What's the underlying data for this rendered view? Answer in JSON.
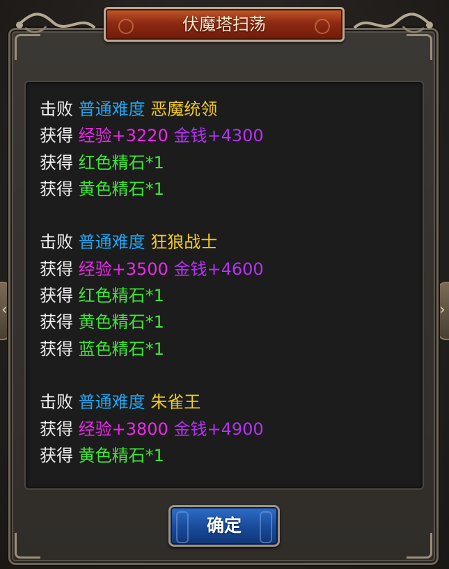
{
  "dialog": {
    "title": "伏魔塔扫荡"
  },
  "colors": {
    "label": "#f2f2f2",
    "difficulty": "#1ea6f0",
    "boss": "#f2cc1e",
    "exp": "#ea28ea",
    "money": "#b432f2",
    "item": "#3de636"
  },
  "results": [
    {
      "defeat_label": "击败",
      "difficulty": "普通难度",
      "boss": "恶魔统领",
      "gain_label": "获得",
      "exp": "经验+3220",
      "money": "金钱+4300",
      "items": [
        {
          "label": "获得",
          "name": "红色精石*1"
        },
        {
          "label": "获得",
          "name": "黄色精石*1"
        }
      ]
    },
    {
      "defeat_label": "击败",
      "difficulty": "普通难度",
      "boss": "狂狼战士",
      "gain_label": "获得",
      "exp": "经验+3500",
      "money": "金钱+4600",
      "items": [
        {
          "label": "获得",
          "name": "红色精石*1"
        },
        {
          "label": "获得",
          "name": "黄色精石*1"
        },
        {
          "label": "获得",
          "name": "蓝色精石*1"
        }
      ]
    },
    {
      "defeat_label": "击败",
      "difficulty": "普通难度",
      "boss": "朱雀王",
      "gain_label": "获得",
      "exp": "经验+3800",
      "money": "金钱+4900",
      "items": [
        {
          "label": "获得",
          "name": "黄色精石*1"
        }
      ]
    }
  ],
  "buttons": {
    "confirm": "确定"
  }
}
